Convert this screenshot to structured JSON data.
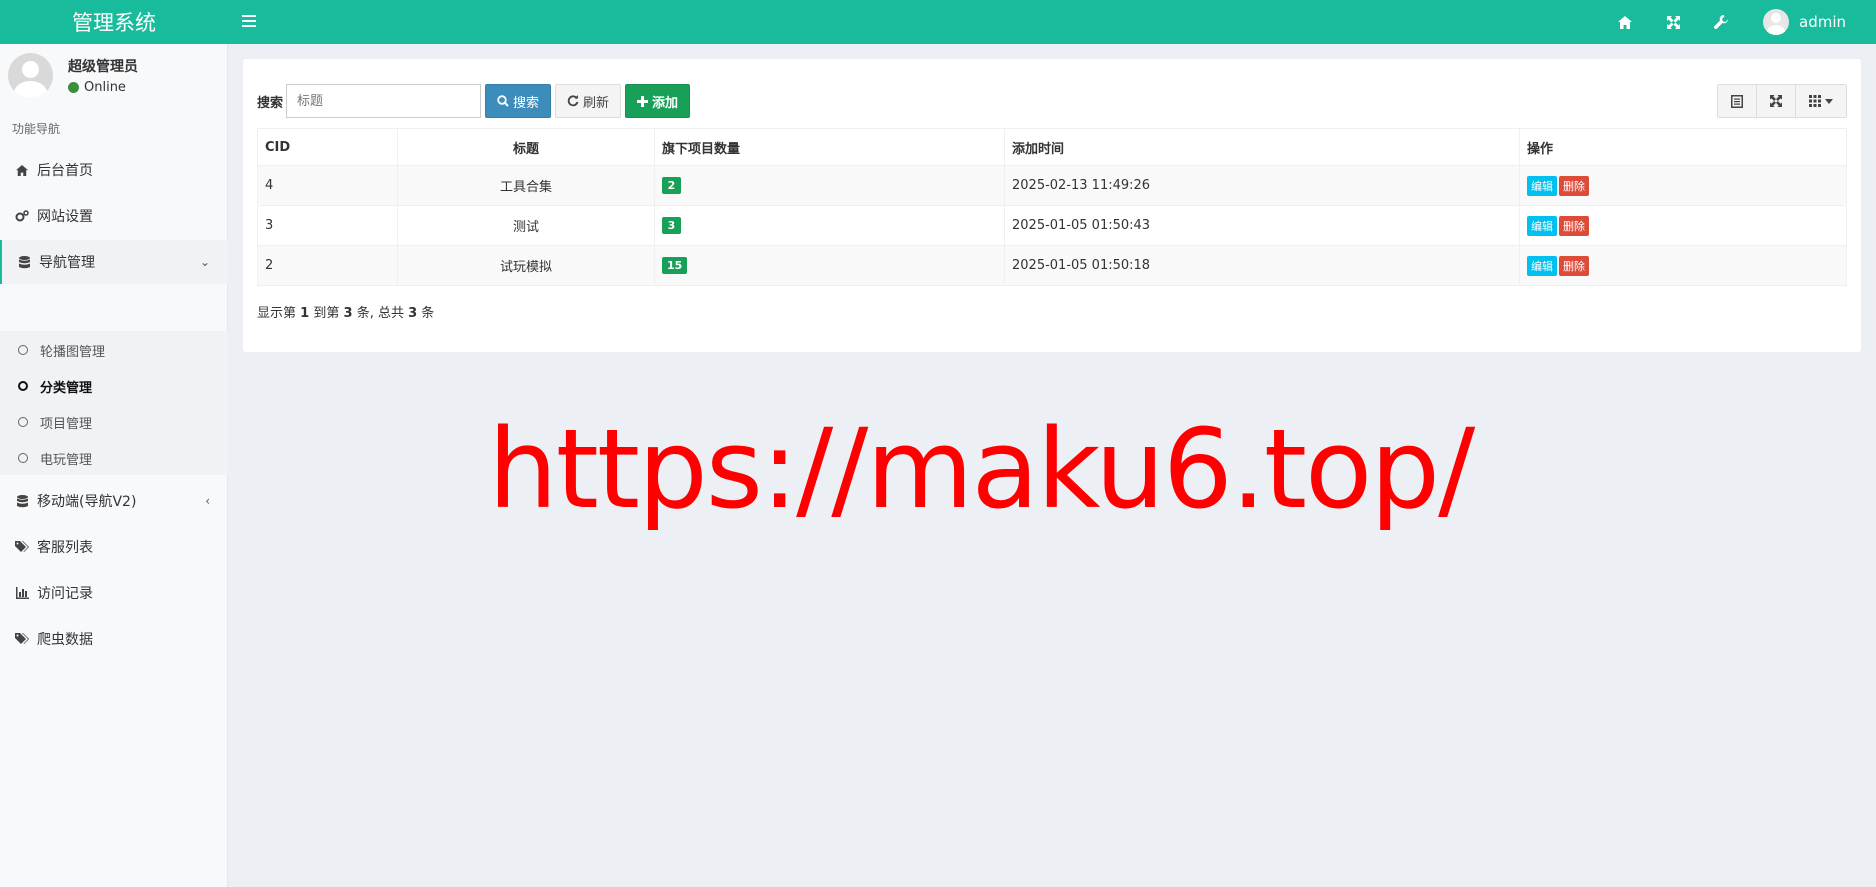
{
  "header": {
    "logo": "管理系统",
    "username": "admin"
  },
  "sidebar": {
    "user_name": "超级管理员",
    "user_status": "Online",
    "menu_header": "功能导航",
    "items": [
      {
        "label": "后台首页",
        "icon": "home-icon"
      },
      {
        "label": "网站设置",
        "icon": "gears-icon"
      },
      {
        "label": "导航管理",
        "icon": "database-icon"
      },
      {
        "label": "移动端(导航V2)",
        "icon": "database-icon"
      },
      {
        "label": "客服列表",
        "icon": "tags-icon"
      },
      {
        "label": "访问记录",
        "icon": "bar-chart-icon"
      },
      {
        "label": "爬虫数据",
        "icon": "tags-icon"
      }
    ],
    "sub_items": [
      {
        "label": "轮播图管理"
      },
      {
        "label": "分类管理"
      },
      {
        "label": "项目管理"
      },
      {
        "label": "电玩管理"
      }
    ]
  },
  "toolbar": {
    "search_label": "搜索",
    "search_placeholder": "标题",
    "search_button": "搜索",
    "refresh_button": "刷新",
    "add_button": "添加"
  },
  "table": {
    "headers": [
      "CID",
      "标题",
      "旗下项目数量",
      "添加时间",
      "操作"
    ],
    "rows": [
      {
        "cid": "4",
        "title": "工具合集",
        "count": "2",
        "time": "2025-02-13 11:49:26"
      },
      {
        "cid": "3",
        "title": "测试",
        "count": "3",
        "time": "2025-01-05 01:50:43"
      },
      {
        "cid": "2",
        "title": "试玩模拟",
        "count": "15",
        "time": "2025-01-05 01:50:18"
      }
    ],
    "edit_label": "编辑",
    "delete_label": "删除"
  },
  "pagination": {
    "prefix": "显示第",
    "from": "1",
    "mid1": "到第",
    "to": "3",
    "mid2": "条, 总共",
    "total": "3",
    "suffix": "条"
  },
  "watermark": "https://maku6.top/",
  "colors": {
    "header": "#18bc9c",
    "primary": "#3c8dbc",
    "success": "#18a058",
    "info": "#00c0ef",
    "danger": "#dd4b39",
    "watermark": "#ff0000"
  }
}
